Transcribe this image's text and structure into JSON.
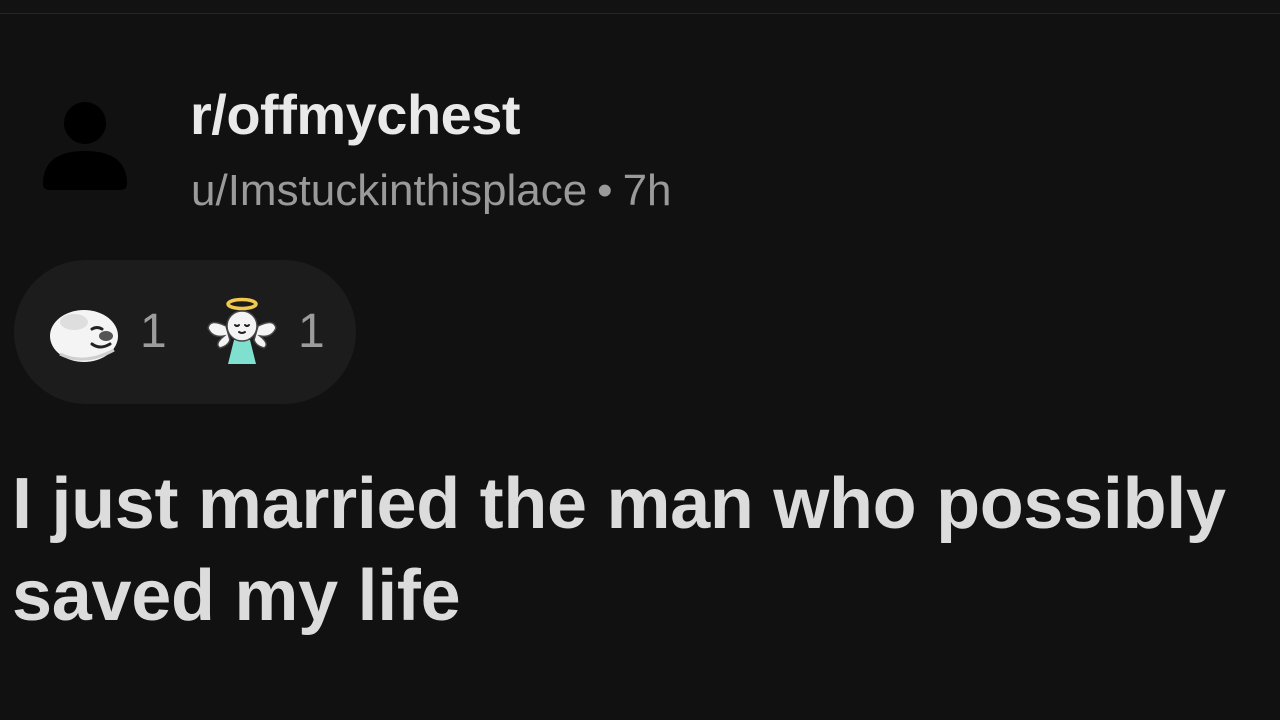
{
  "post": {
    "subreddit": "r/offmychest",
    "author": "u/Imstuckinthisplace",
    "separator": "•",
    "age": "7h",
    "title": "I just married the man who possibly saved my life"
  },
  "awards": [
    {
      "icon": "seal-award-icon",
      "count": "1"
    },
    {
      "icon": "angel-award-icon",
      "count": "1"
    }
  ],
  "colors": {
    "background": "#111111",
    "pill": "#1c1c1c",
    "title_text": "#dcdcdc",
    "meta_text": "#9a9a9a",
    "angel_body": "#7fe0d0",
    "halo": "#f2c94c"
  }
}
